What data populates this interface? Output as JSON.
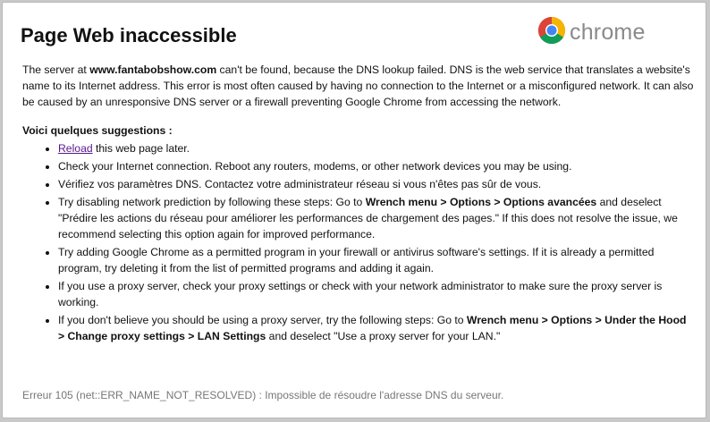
{
  "page": {
    "title": "Page Web inaccessible",
    "logo_word": "chrome"
  },
  "intro": {
    "prefix": "The server at ",
    "host": "www.fantabobshow.com",
    "suffix": " can't be found, because the DNS lookup failed. DNS is the web service that translates a website's name to its Internet address. This error is most often caused by having no connection to the Internet or a misconfigured network. It can also be caused by an unresponsive DNS server or a firewall preventing Google Chrome from accessing the network."
  },
  "suggestions": {
    "heading": "Voici quelques suggestions :",
    "reload_link": "Reload",
    "reload_rest": " this web page later.",
    "item2": "Check your Internet connection. Reboot any routers, modems, or other network devices you may be using.",
    "item3": "Vérifiez vos paramètres DNS. Contactez votre administrateur réseau si vous n'êtes pas sûr de vous.",
    "item4_a": "Try disabling network prediction by following these steps: Go to ",
    "item4_b": "Wrench menu > Options > Options avancées",
    "item4_c": " and deselect \"Prédire les actions du réseau pour améliorer les performances de chargement des pages.\" If this does not resolve the issue, we recommend selecting this option again for improved performance.",
    "item5": "Try adding Google Chrome as a permitted program in your firewall or antivirus software's settings. If it is already a permitted program, try deleting it from the list of permitted programs and adding it again.",
    "item6": "If you use a proxy server, check your proxy settings or check with your network administrator to make sure the proxy server is working.",
    "item7_a": "If you don't believe you should be using a proxy server, try the following steps: Go to ",
    "item7_b": "Wrench menu > Options > Under the Hood > Change proxy settings > LAN Settings",
    "item7_c": " and deselect \"Use a proxy server for your LAN.\""
  },
  "footer": {
    "error": "Erreur 105 (net::ERR_NAME_NOT_RESOLVED) : Impossible de résoudre l'adresse DNS du serveur."
  },
  "colors": {
    "link": "#551a8b",
    "footer_text": "#777777"
  },
  "icons": {
    "logo": "chrome-logo-icon"
  }
}
